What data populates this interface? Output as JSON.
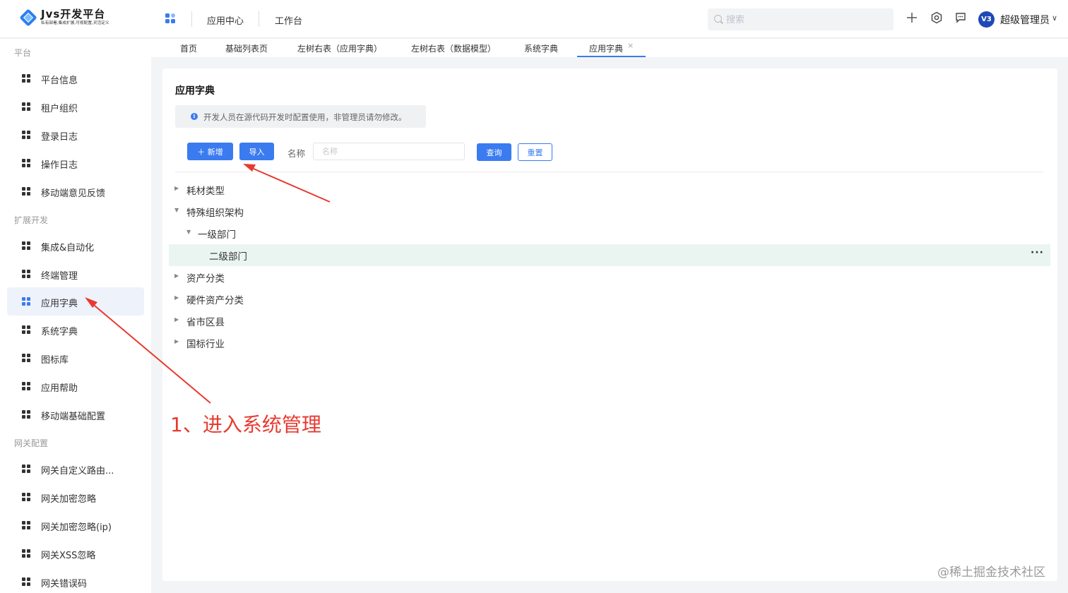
{
  "app": {
    "logo_title": "Jvs开发平台",
    "logo_subtitle": "私有部署,集成扩展,可视配置,灵活定义",
    "brand_color": "#3a7bf0"
  },
  "header": {
    "nav": [
      "应用中心",
      "工作台"
    ],
    "search_placeholder": "搜索",
    "icons": [
      "plus-icon",
      "gear-icon",
      "message-icon"
    ],
    "avatar_text": "V3",
    "user_name": "超级管理员"
  },
  "tabs": {
    "items": [
      "首页",
      "基础列表页",
      "左树右表（应用字典）",
      "左树右表（数据模型）",
      "系统字典",
      "应用字典"
    ],
    "active_index": 5,
    "close_glyph": "×"
  },
  "sidebar": {
    "groups": [
      {
        "label": "平台",
        "items": [
          "平台信息",
          "租户组织",
          "登录日志",
          "操作日志",
          "移动端意见反馈"
        ]
      },
      {
        "label": "扩展开发",
        "items": [
          "集成&自动化",
          "终端管理",
          "应用字典",
          "系统字典",
          "图标库",
          "应用帮助",
          "移动端基础配置"
        ]
      },
      {
        "label": "网关配置",
        "items": [
          "网关自定义路由...",
          "网关加密忽略",
          "网关加密忽略(ip)",
          "网关XSS忽略",
          "网关错误码"
        ]
      }
    ],
    "active_item": "应用字典"
  },
  "main": {
    "title": "应用字典",
    "notice": "开发人员在源代码开发时配置使用，非管理员请勿修改。",
    "add_button": "＋ 新增",
    "import_button": "导入",
    "name_label": "名称",
    "name_placeholder": "名称",
    "query_button": "查询",
    "reset_button": "重置",
    "more_glyph": "···",
    "tree": [
      {
        "label": "耗材类型",
        "level": 0,
        "expanded": false,
        "has_children": true
      },
      {
        "label": "特殊组织架构",
        "level": 0,
        "expanded": true,
        "has_children": true
      },
      {
        "label": "一级部门",
        "level": 1,
        "expanded": true,
        "has_children": true
      },
      {
        "label": "二级部门",
        "level": 2,
        "expanded": false,
        "has_children": false,
        "selected": true
      },
      {
        "label": "资产分类",
        "level": 0,
        "expanded": false,
        "has_children": true
      },
      {
        "label": "硬件资产分类",
        "level": 0,
        "expanded": false,
        "has_children": true
      },
      {
        "label": "省市区县",
        "level": 0,
        "expanded": false,
        "has_children": true
      },
      {
        "label": "国标行业",
        "level": 0,
        "expanded": false,
        "has_children": true
      }
    ]
  },
  "annotation": {
    "text": "1、进入系统管理",
    "color": "#e83a30"
  },
  "site_watermark": "@稀土掘金技术社区"
}
